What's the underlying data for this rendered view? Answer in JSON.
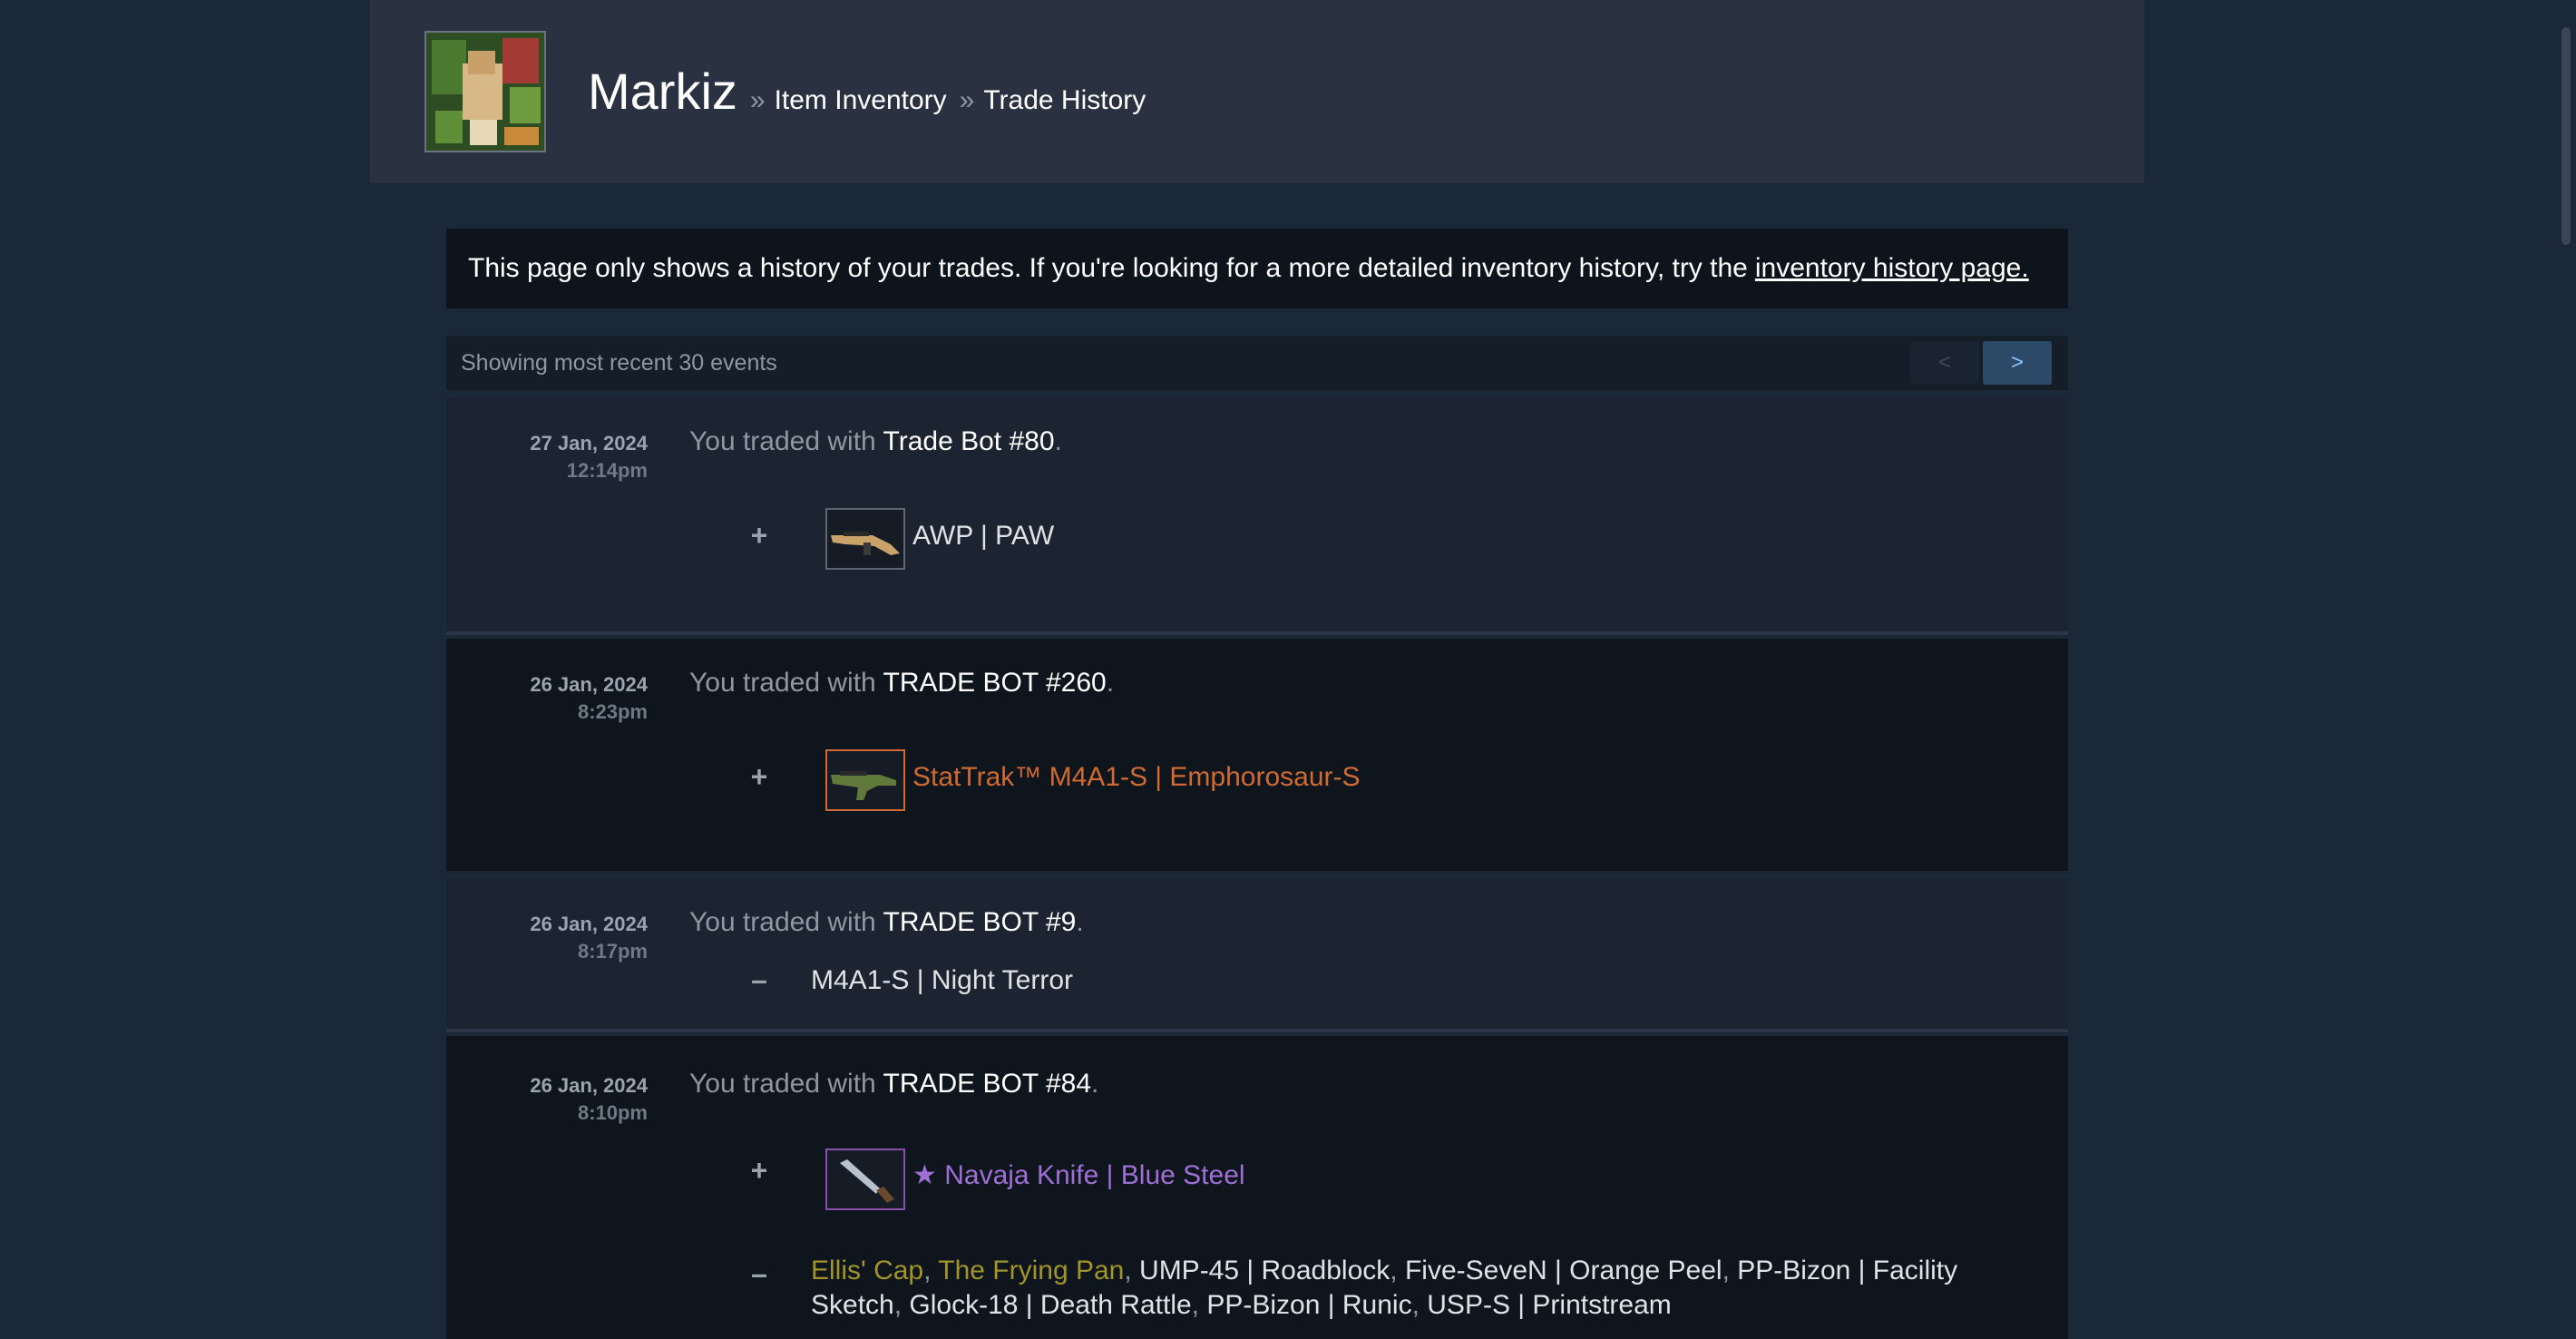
{
  "profile": {
    "persona_name": "Markiz",
    "separator": "»",
    "breadcrumb_inventory": "Item Inventory",
    "breadcrumb_trade_history": "Trade History"
  },
  "notice": {
    "text": "This page only shows a history of your trades. If you're looking for a more detailed inventory history, try the",
    "link_text": "inventory history page."
  },
  "pager": {
    "status_text": "Showing most recent 30 events",
    "prev_label": "<",
    "next_label": ">"
  },
  "trade_prefix": "You traded with",
  "period": ".",
  "plus_sign": "+",
  "minus_sign": "–",
  "trades": [
    {
      "date": "27 Jan, 2024",
      "time": "12:14pm",
      "partner": "Trade Bot #80",
      "received": [
        {
          "name": "AWP | PAW",
          "quality_color": "#dfe3e6"
        }
      ]
    },
    {
      "date": "26 Jan, 2024",
      "time": "8:23pm",
      "partner": "TRADE BOT #260",
      "received": [
        {
          "name": "StatTrak™ M4A1-S | Emphorosaur-S",
          "quality_color": "#cf6a32"
        }
      ]
    },
    {
      "date": "26 Jan, 2024",
      "time": "8:17pm",
      "partner": "TRADE BOT #9",
      "given": [
        {
          "name": "M4A1-S | Night Terror",
          "quality_color": "#dfe3e6"
        }
      ]
    },
    {
      "date": "26 Jan, 2024",
      "time": "8:10pm",
      "partner": "TRADE BOT #84",
      "received": [
        {
          "name": "★ Navaja Knife | Blue Steel",
          "quality_color": "#9f6fd6"
        }
      ],
      "given": [
        {
          "name": "Ellis' Cap",
          "quality_color": "#a0942a"
        },
        {
          "name": "The Frying Pan",
          "quality_color": "#a0942a"
        },
        {
          "name": "UMP-45 | Roadblock",
          "quality_color": "#dfe3e6"
        },
        {
          "name": "Five-SeveN | Orange Peel",
          "quality_color": "#dfe3e6"
        },
        {
          "name": "PP-Bizon | Facility Sketch",
          "quality_color": "#dfe3e6"
        },
        {
          "name": "Glock-18 | Death Rattle",
          "quality_color": "#dfe3e6"
        },
        {
          "name": "PP-Bizon | Runic",
          "quality_color": "#dfe3e6"
        },
        {
          "name": "USP-S | Printstream",
          "quality_color": "#dfe3e6"
        }
      ]
    }
  ],
  "comma": ","
}
